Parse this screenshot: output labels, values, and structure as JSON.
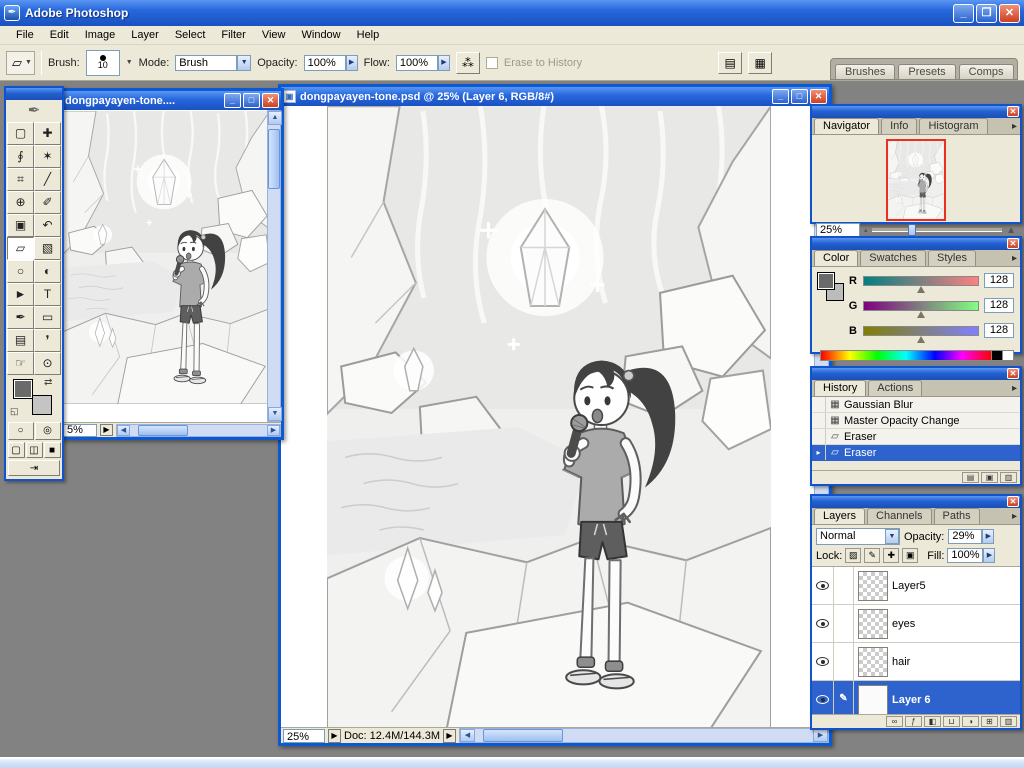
{
  "colors": {
    "titlebar_blue": "#2767dd",
    "selection_blue": "#2e62cc",
    "close_red": "#cc4022",
    "workspace_gray": "#828282"
  },
  "window": {
    "title": "Adobe Photoshop",
    "menu": [
      "File",
      "Edit",
      "Image",
      "Layer",
      "Select",
      "Filter",
      "View",
      "Window",
      "Help"
    ]
  },
  "options": {
    "brush_label": "Brush:",
    "brush_size": "10",
    "mode_label": "Mode:",
    "mode_value": "Brush",
    "opacity_label": "Opacity:",
    "opacity_value": "100%",
    "flow_label": "Flow:",
    "flow_value": "100%",
    "erase_history_label": "Erase to History",
    "palette_well": [
      "Brushes",
      "Presets",
      "Comps"
    ]
  },
  "toolbox": {
    "tools": [
      {
        "name": "rectangular-marquee",
        "glyph": "▢"
      },
      {
        "name": "move",
        "glyph": "✚"
      },
      {
        "name": "lasso",
        "glyph": "∮"
      },
      {
        "name": "magic-wand",
        "glyph": "✶"
      },
      {
        "name": "crop",
        "glyph": "⌗"
      },
      {
        "name": "slice",
        "glyph": "╱"
      },
      {
        "name": "healing-brush",
        "glyph": "⊕"
      },
      {
        "name": "brush",
        "glyph": "✐"
      },
      {
        "name": "clone-stamp",
        "glyph": "▣"
      },
      {
        "name": "history-brush",
        "glyph": "↶"
      },
      {
        "name": "eraser",
        "glyph": "▱",
        "selected": true
      },
      {
        "name": "gradient",
        "glyph": "▧"
      },
      {
        "name": "blur",
        "glyph": "○"
      },
      {
        "name": "dodge",
        "glyph": "◐"
      },
      {
        "name": "path-selection",
        "glyph": "►"
      },
      {
        "name": "type",
        "glyph": "T"
      },
      {
        "name": "pen",
        "glyph": "✒"
      },
      {
        "name": "shape",
        "glyph": "▭"
      },
      {
        "name": "notes",
        "glyph": "▤"
      },
      {
        "name": "eyedropper",
        "glyph": "❜"
      },
      {
        "name": "hand",
        "glyph": "☞"
      },
      {
        "name": "zoom",
        "glyph": "⊙"
      }
    ]
  },
  "docs": {
    "small": {
      "title": "dongpayayen-tone....",
      "zoom": "5%"
    },
    "main": {
      "title": "dongpayayen-tone.psd @ 25% (Layer 6, RGB/8#)",
      "zoom": "25%",
      "doc_info": "Doc: 12.4M/144.3M"
    }
  },
  "panels": {
    "navigator": {
      "tabs": [
        "Navigator",
        "Info",
        "Histogram"
      ],
      "zoom": "25%"
    },
    "color": {
      "tabs": [
        "Color",
        "Swatches",
        "Styles"
      ],
      "channels": [
        {
          "label": "R",
          "value": "128"
        },
        {
          "label": "G",
          "value": "128"
        },
        {
          "label": "B",
          "value": "128"
        }
      ]
    },
    "history": {
      "tabs": [
        "History",
        "Actions"
      ],
      "entries": [
        {
          "label": "Gaussian Blur",
          "glyph": "▦",
          "selected": false
        },
        {
          "label": "Master Opacity Change",
          "glyph": "▦",
          "selected": false
        },
        {
          "label": "Eraser",
          "glyph": "▱",
          "selected": false
        },
        {
          "label": "Eraser",
          "glyph": "▱",
          "selected": true
        }
      ]
    },
    "layers": {
      "tabs": [
        "Layers",
        "Channels",
        "Paths"
      ],
      "blend_mode": "Normal",
      "opacity_label": "Opacity:",
      "opacity_value": "29%",
      "lock_label": "Lock:",
      "fill_label": "Fill:",
      "fill_value": "100%",
      "items": [
        {
          "name": "Layer5",
          "selected": false
        },
        {
          "name": "eyes",
          "selected": false
        },
        {
          "name": "hair",
          "selected": false
        },
        {
          "name": "Layer 6",
          "selected": true
        }
      ]
    }
  },
  "icons": {
    "close": "✕",
    "minimize": "_",
    "maximize": "□",
    "restore": "❐",
    "dropdown": "▼",
    "popup": "▶",
    "panel_menu": "▸",
    "scroll_left": "◀",
    "scroll_right": "▶",
    "scroll_up": "▲",
    "scroll_down": "▼",
    "airbrush": "⁂",
    "file_browser": "▤",
    "palette_toggle": "▦",
    "feather": "✒",
    "swap": "⇄",
    "default_colors": "◱",
    "mask_standard": "○",
    "mask_quick": "◎",
    "screen_standard": "▢",
    "screen_full_menu": "◫",
    "screen_full": "■",
    "jump_imageready": "⇥",
    "zoom_out_small": "▴",
    "zoom_in_big": "▲",
    "new_doc_state": "▤",
    "new_snapshot": "▣",
    "trash": "▥",
    "link": "∞",
    "style": "ƒ",
    "mask": "◧",
    "set": "⊔",
    "adjust": "◑",
    "new_layer": "⊞",
    "lock_transparency": "▨",
    "lock_pixels": "✎",
    "lock_position": "✚",
    "lock_all": "▣",
    "black_triangle": "▶",
    "history_pointer": "▸"
  }
}
